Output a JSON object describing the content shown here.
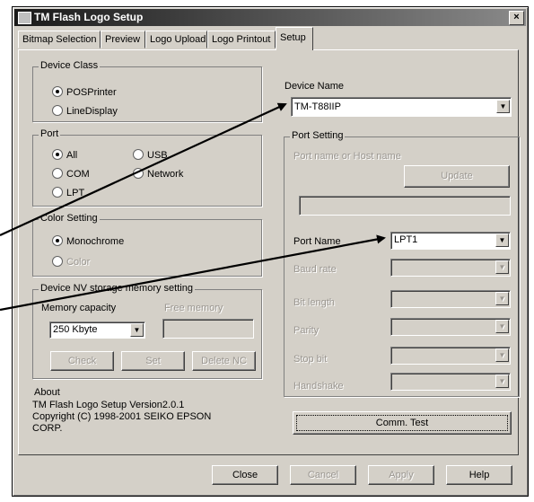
{
  "window": {
    "title": "TM Flash Logo Setup",
    "close_glyph": "×"
  },
  "tabs": [
    {
      "label": "Bitmap Selection"
    },
    {
      "label": "Preview"
    },
    {
      "label": "Logo Upload"
    },
    {
      "label": "Logo Printout"
    },
    {
      "label": "Setup",
      "active": true
    }
  ],
  "device_class": {
    "label": "Device Class",
    "options": [
      "POSPrinter",
      "LineDisplay"
    ],
    "selected": "POSPrinter"
  },
  "port": {
    "label": "Port",
    "options": [
      "All",
      "USB",
      "COM",
      "Network",
      "LPT"
    ],
    "selected": "All"
  },
  "color_setting": {
    "label": "Color Setting",
    "options": [
      "Monochrome",
      "Color"
    ],
    "selected": "Monochrome"
  },
  "memory": {
    "label": "Device NV storage memory setting",
    "capacity_label": "Memory capacity",
    "capacity_value": "250 Kbyte",
    "free_label": "Free memory",
    "buttons": [
      "Check",
      "Set",
      "Delete NC"
    ]
  },
  "about": {
    "label": "About",
    "lines": [
      "TM Flash Logo Setup Version2.0.1",
      "Copyright (C) 1998-2001 SEIKO EPSON",
      "CORP."
    ]
  },
  "device_name": {
    "label": "Device Name",
    "value": "TM-T88IIP"
  },
  "port_setting": {
    "label": "Port Setting",
    "host_label": "Port name or Host name",
    "update_label": "Update",
    "port_name_label": "Port Name",
    "port_name_value": "LPT1",
    "disabled_labels": [
      "Baud rate",
      "Bit length",
      "Parity",
      "Stop bit",
      "Handshake"
    ]
  },
  "comm_test_label": "Comm. Test",
  "bottom_buttons": [
    "Close",
    "Cancel",
    "Apply",
    "Help"
  ],
  "icons": {
    "combo_arrow": "▼"
  },
  "colors": {
    "face": "#d4d0c8",
    "title_start": "#1a1a1a",
    "title_end": "#8a8a8a",
    "disabled_text": "#9a9690"
  }
}
